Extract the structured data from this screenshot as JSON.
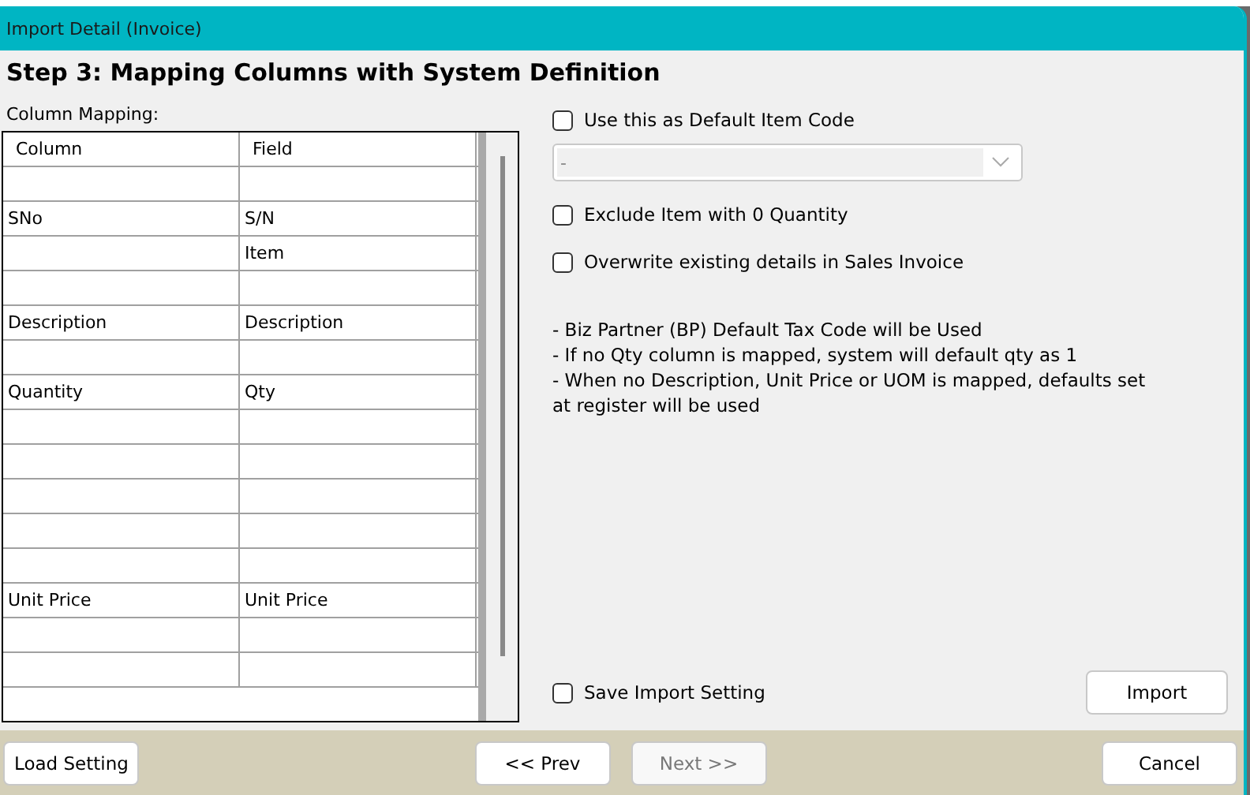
{
  "window": {
    "title": "Import Detail (Invoice)"
  },
  "heading": "Step 3: Mapping Columns with System Definition",
  "mapping": {
    "label": "Column Mapping:",
    "columns": [
      "Column",
      "Field"
    ],
    "rows": [
      [
        "",
        ""
      ],
      [
        "SNo",
        "S/N"
      ],
      [
        "",
        "Item"
      ],
      [
        "",
        ""
      ],
      [
        "Description",
        "Description"
      ],
      [
        "",
        ""
      ],
      [
        "Quantity",
        "Qty"
      ],
      [
        "",
        ""
      ],
      [
        "",
        ""
      ],
      [
        "",
        ""
      ],
      [
        "",
        ""
      ],
      [
        "",
        ""
      ],
      [
        "Unit Price",
        "Unit Price"
      ],
      [
        "",
        ""
      ],
      [
        "",
        ""
      ]
    ]
  },
  "default_item": {
    "label": "Use this as Default Item Code",
    "checked": false
  },
  "item_code_dropdown": {
    "value": "-",
    "disabled": true
  },
  "options": [
    {
      "label": "Exclude Item with 0 Quantity",
      "checked": false
    },
    {
      "label": "Overwrite existing details in Sales Invoice",
      "checked": false
    }
  ],
  "notes": [
    "- Biz Partner (BP) Default Tax Code will be Used",
    "- If no Qty column is mapped, system will default qty as 1",
    "- When no Description, Unit Price or UOM is mapped, defaults set at register will be used"
  ],
  "save_setting": {
    "label": "Save Import Setting",
    "checked": false
  },
  "import_button": {
    "label": "Import"
  },
  "footer": [
    {
      "label": "Load Setting",
      "disabled": false
    },
    {
      "label": "<< Prev",
      "disabled": false
    },
    {
      "label": "Next >>",
      "disabled": true
    },
    {
      "label": "Cancel",
      "disabled": false
    }
  ]
}
